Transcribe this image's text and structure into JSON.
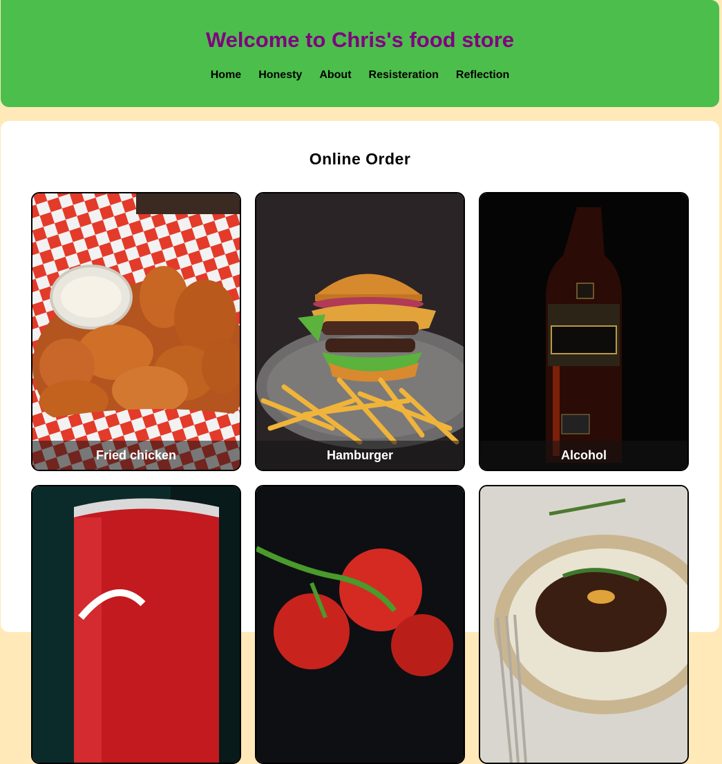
{
  "header": {
    "title": "Welcome to Chris's food store",
    "nav": [
      "Home",
      "Honesty",
      "About",
      "Resisteration",
      "Reflection"
    ]
  },
  "main": {
    "heading": "Online Order",
    "cards": [
      {
        "label": "Fried chicken",
        "image": "fried-chicken-photo"
      },
      {
        "label": "Hamburger",
        "image": "hamburger-photo"
      },
      {
        "label": "Alcohol",
        "image": "whisky-bottle-photo"
      },
      {
        "label": "",
        "image": "cola-can-photo"
      },
      {
        "label": "",
        "image": "tomatoes-photo"
      },
      {
        "label": "",
        "image": "steak-photo"
      }
    ]
  },
  "colors": {
    "header_bg": "#4cbe4c",
    "title": "#800080",
    "page_bg": "#ffe9b8"
  }
}
